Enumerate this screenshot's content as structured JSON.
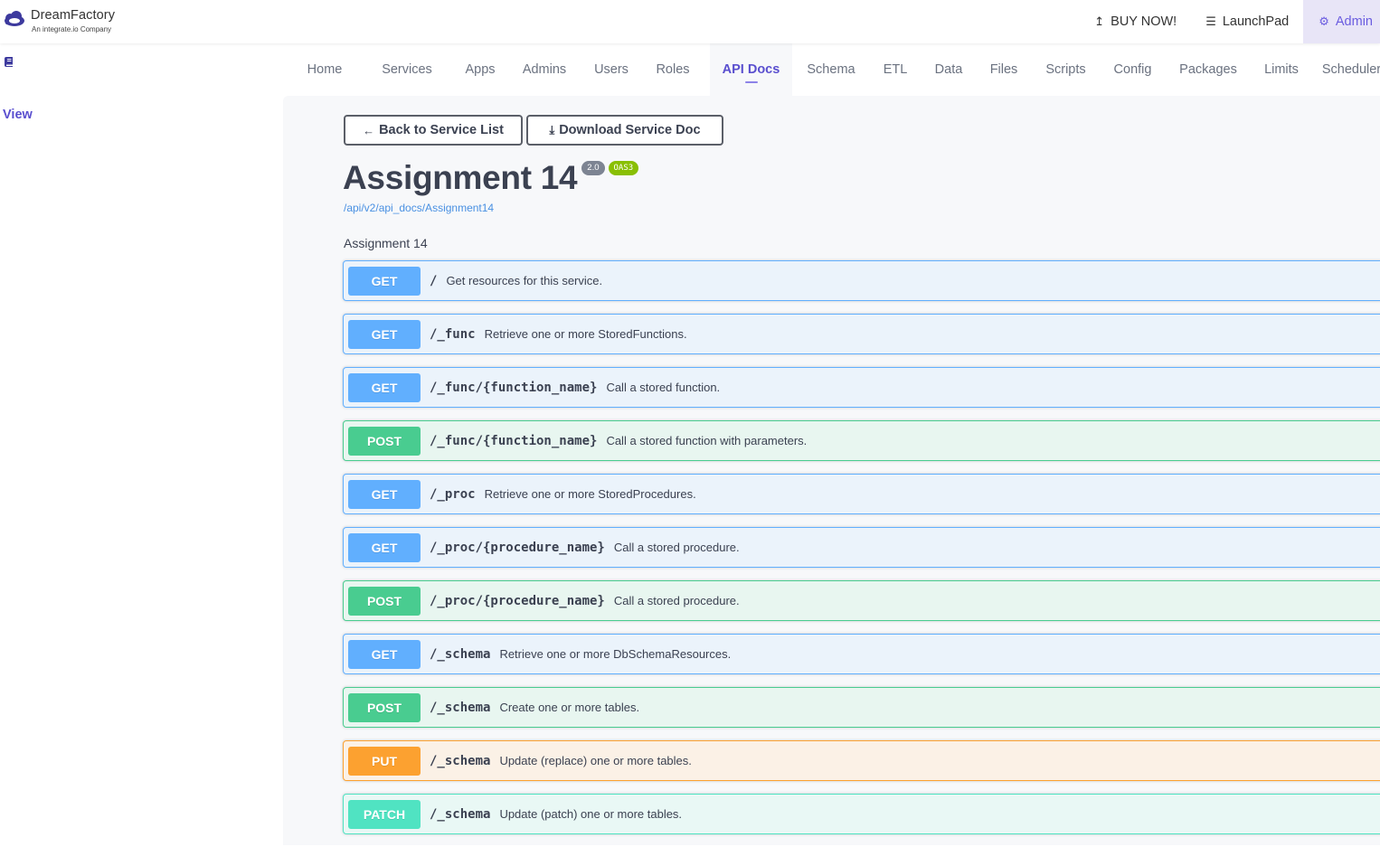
{
  "header": {
    "brand_name": "DreamFactory",
    "brand_sub": "An integrate.io Company",
    "actions": [
      {
        "label": "BUY NOW!",
        "icon": "upload-arrow-icon"
      },
      {
        "label": "LaunchPad",
        "icon": "menu-icon"
      },
      {
        "label": "Admin",
        "icon": "gear-icon"
      }
    ]
  },
  "sidebar": {
    "view_label": "View"
  },
  "nav": {
    "tabs": [
      "Home",
      "Services",
      "Apps",
      "Admins",
      "Users",
      "Roles",
      "API Docs",
      "Schema",
      "ETL",
      "Data",
      "Files",
      "Scripts",
      "Config",
      "Packages",
      "Limits",
      "Scheduler"
    ],
    "active": "API Docs"
  },
  "doc": {
    "back_label": "Back to Service List",
    "download_label": "Download Service Doc",
    "title": "Assignment 14",
    "version_badge": "2.0",
    "oas_badge": "OAS3",
    "url": "/api/v2/api_docs/Assignment14",
    "description": "Assignment 14"
  },
  "operations": [
    {
      "method": "GET",
      "path": "/",
      "summary": "Get resources for this service."
    },
    {
      "method": "GET",
      "path": "/_func",
      "summary": "Retrieve one or more StoredFunctions."
    },
    {
      "method": "GET",
      "path": "/_func/{function_name}",
      "summary": "Call a stored function."
    },
    {
      "method": "POST",
      "path": "/_func/{function_name}",
      "summary": "Call a stored function with parameters."
    },
    {
      "method": "GET",
      "path": "/_proc",
      "summary": "Retrieve one or more StoredProcedures."
    },
    {
      "method": "GET",
      "path": "/_proc/{procedure_name}",
      "summary": "Call a stored procedure."
    },
    {
      "method": "POST",
      "path": "/_proc/{procedure_name}",
      "summary": "Call a stored procedure."
    },
    {
      "method": "GET",
      "path": "/_schema",
      "summary": "Retrieve one or more DbSchemaResources."
    },
    {
      "method": "POST",
      "path": "/_schema",
      "summary": "Create one or more tables."
    },
    {
      "method": "PUT",
      "path": "/_schema",
      "summary": "Update (replace) one or more tables."
    },
    {
      "method": "PATCH",
      "path": "/_schema",
      "summary": "Update (patch) one or more tables."
    }
  ],
  "colors": {
    "accent": "#5a4fcf",
    "get": "#61affe",
    "post": "#49cc90",
    "put": "#fca130",
    "patch": "#50e3c2"
  }
}
